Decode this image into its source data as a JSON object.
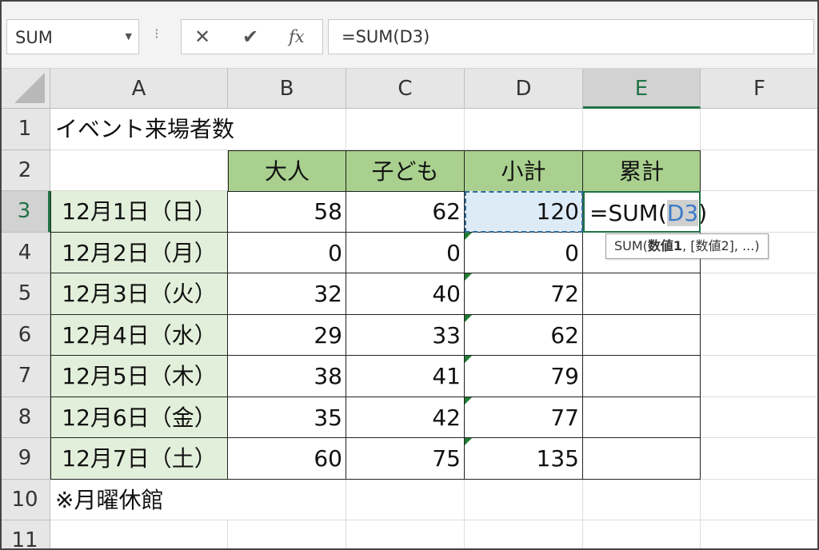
{
  "formula_bar": {
    "name_box": "SUM",
    "cancel_icon": "✕",
    "enter_icon": "✔",
    "fx_label": "fx",
    "formula": "=SUM(D3)"
  },
  "columns": [
    "A",
    "B",
    "C",
    "D",
    "E",
    "F"
  ],
  "active_column": "E",
  "rows": [
    "1",
    "2",
    "3",
    "4",
    "5",
    "6",
    "7",
    "8",
    "9",
    "10",
    "11"
  ],
  "active_row": "3",
  "title": "イベント来場者数",
  "headers": {
    "adult": "大人",
    "child": "子ども",
    "subtotal": "小計",
    "cumulative": "累計"
  },
  "table": [
    {
      "date": "12月1日（日）",
      "adult": "58",
      "child": "62",
      "subtotal": "120"
    },
    {
      "date": "12月2日（月）",
      "adult": "0",
      "child": "0",
      "subtotal": "0"
    },
    {
      "date": "12月3日（火）",
      "adult": "32",
      "child": "40",
      "subtotal": "72"
    },
    {
      "date": "12月4日（水）",
      "adult": "29",
      "child": "33",
      "subtotal": "62"
    },
    {
      "date": "12月5日（木）",
      "adult": "38",
      "child": "41",
      "subtotal": "79"
    },
    {
      "date": "12月6日（金）",
      "adult": "35",
      "child": "42",
      "subtotal": "77"
    },
    {
      "date": "12月7日（土）",
      "adult": "60",
      "child": "75",
      "subtotal": "135"
    }
  ],
  "editing_cell": {
    "prefix": "=SUM(",
    "ref": "D3",
    "suffix": ")"
  },
  "tooltip": {
    "fn": "SUM(",
    "arg1": "数値1",
    "rest": ", [数値2], ...)"
  },
  "note": "※月曜休館",
  "colors": {
    "header_green": "#a9d08e",
    "date_green": "#e2efda",
    "excel_green": "#217346",
    "ref_blue": "#3b7bc8"
  }
}
